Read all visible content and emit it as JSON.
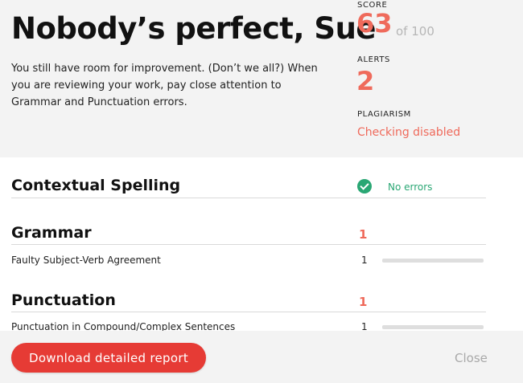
{
  "header": {
    "title": "Nobody’s perfect, Sue",
    "summary": "You still have room for improvement. (Don’t we all?) When you are reviewing your work, pay close attention to Grammar and Punctuation errors."
  },
  "stats": {
    "score_label": "SCORE",
    "score_value": "63",
    "score_suffix": "of 100",
    "alerts_label": "ALERTS",
    "alerts_value": "2",
    "plagiarism_label": "PLAGIARISM",
    "plagiarism_value": "Checking disabled"
  },
  "sections": {
    "spelling": {
      "title": "Contextual Spelling",
      "status": "No errors",
      "status_icon": "check-circle-icon"
    },
    "grammar": {
      "title": "Grammar",
      "count": "1",
      "items": [
        {
          "label": "Faulty Subject-Verb Agreement",
          "count": "1"
        }
      ]
    },
    "punctuation": {
      "title": "Punctuation",
      "count": "1",
      "items": [
        {
          "label": "Punctuation in Compound/Complex Sentences",
          "count": "1"
        }
      ]
    }
  },
  "footer": {
    "download_label": "Download detailed report",
    "close_label": "Close"
  },
  "colors": {
    "accent": "#ef6a5b",
    "button": "#e63b35",
    "success": "#2aa774"
  }
}
